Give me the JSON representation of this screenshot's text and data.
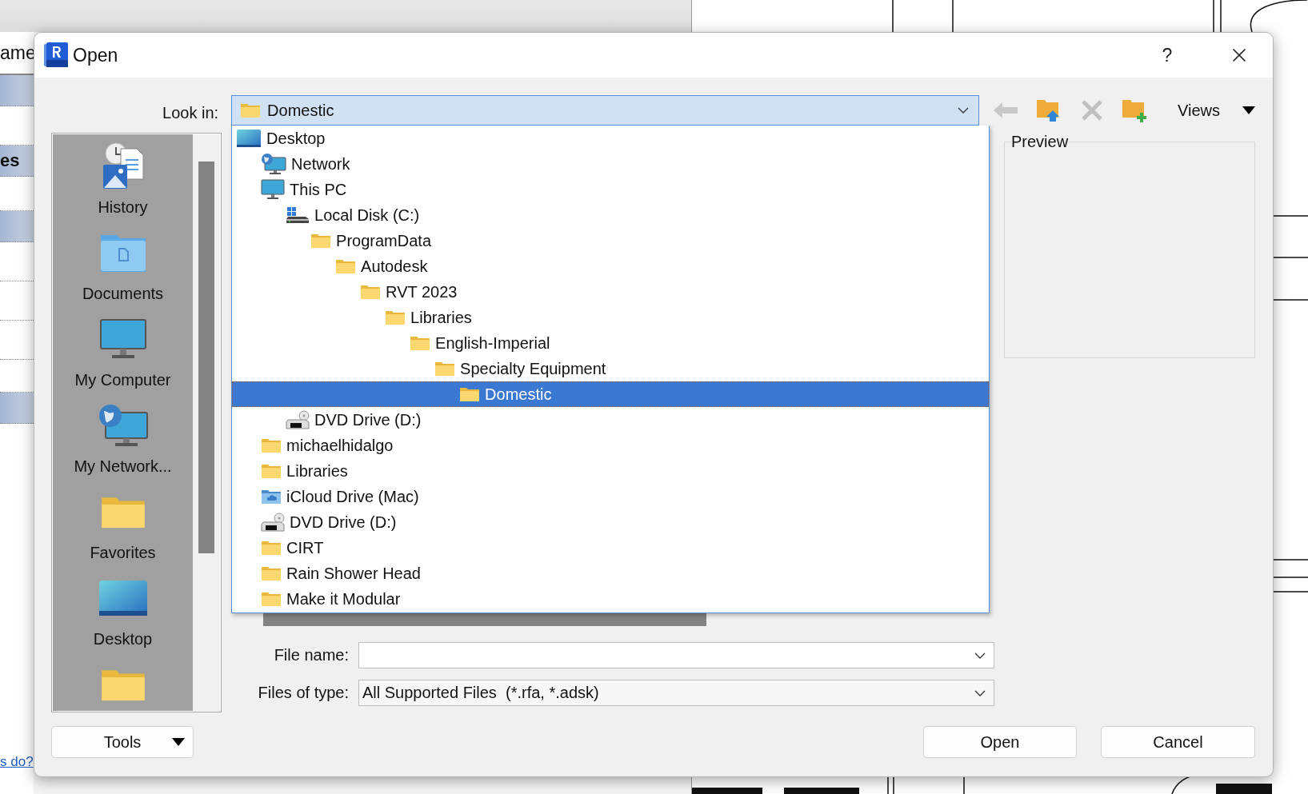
{
  "background": {
    "tab_text": "ame",
    "row_text": "es",
    "link": "s do?"
  },
  "window": {
    "title": "Open",
    "help": "?"
  },
  "look_in": {
    "label": "Look in:",
    "value": "Domestic",
    "kind": "folder"
  },
  "toolbar": {
    "tools": [
      {
        "kind": "back",
        "disabled": true
      },
      {
        "kind": "up",
        "disabled": false
      },
      {
        "kind": "delete",
        "disabled": true
      },
      {
        "kind": "new_folder",
        "disabled": false
      }
    ],
    "views": "Views"
  },
  "tree": [
    {
      "label": "Desktop",
      "kind": "desktop",
      "selected": false,
      "children": [
        {
          "label": "Network",
          "kind": "network",
          "selected": false
        },
        {
          "label": "This PC",
          "kind": "pc",
          "selected": false,
          "children": [
            {
              "label": "Local Disk (C:)",
              "kind": "drive",
              "selected": false,
              "children": [
                {
                  "label": "ProgramData",
                  "kind": "folder",
                  "selected": false,
                  "children": [
                    {
                      "label": "Autodesk",
                      "kind": "folder",
                      "selected": false,
                      "children": [
                        {
                          "label": "RVT 2023",
                          "kind": "folder",
                          "selected": false,
                          "children": [
                            {
                              "label": "Libraries",
                              "kind": "folder",
                              "selected": false,
                              "children": [
                                {
                                  "label": "English-Imperial",
                                  "kind": "folder",
                                  "selected": false,
                                  "children": [
                                    {
                                      "label": "Specialty Equipment",
                                      "kind": "folder",
                                      "selected": false,
                                      "children": [
                                        {
                                          "label": "Domestic",
                                          "kind": "folder",
                                          "selected": true
                                        }
                                      ]
                                    }
                                  ]
                                }
                              ]
                            }
                          ]
                        }
                      ]
                    }
                  ]
                }
              ]
            },
            {
              "label": "DVD Drive (D:)",
              "kind": "dvd",
              "selected": false
            }
          ]
        },
        {
          "label": "michaelhidalgo",
          "kind": "folder",
          "selected": false
        },
        {
          "label": "Libraries",
          "kind": "folder",
          "selected": false
        },
        {
          "label": "iCloud Drive (Mac)",
          "kind": "cloud",
          "selected": false
        },
        {
          "label": "DVD Drive (D:)",
          "kind": "dvd",
          "selected": false
        },
        {
          "label": "CIRT",
          "kind": "folder",
          "selected": false
        },
        {
          "label": "Rain Shower Head",
          "kind": "folder",
          "selected": false
        },
        {
          "label": "Make it Modular",
          "kind": "folder",
          "selected": false
        }
      ]
    }
  ],
  "places": [
    {
      "label": "History",
      "kind": "history"
    },
    {
      "label": "Documents",
      "kind": "documents"
    },
    {
      "label": "My Computer",
      "kind": "computer"
    },
    {
      "label": "My Network...",
      "kind": "network"
    },
    {
      "label": "Favorites",
      "kind": "folder"
    },
    {
      "label": "Desktop",
      "kind": "desktop"
    },
    {
      "kind": "folder"
    }
  ],
  "preview": {
    "label": "Preview"
  },
  "file_name": {
    "label": "File name:"
  },
  "file_type": {
    "label": "Files of type:",
    "value": "All Supported Files  (*.rfa, *.adsk)"
  },
  "buttons": {
    "tools": "Tools",
    "open": "Open",
    "cancel": "Cancel"
  }
}
